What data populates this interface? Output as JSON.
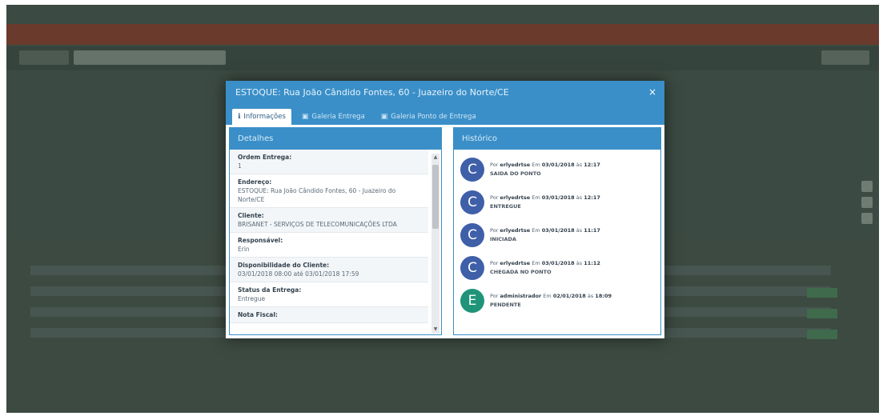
{
  "modal": {
    "title": "ESTOQUE: Rua João Cândido Fontes, 60 - Juazeiro do Norte/CE",
    "close_glyph": "×",
    "tabs": [
      {
        "label": "Informações",
        "icon": "info-icon"
      },
      {
        "label": "Galeria Entrega",
        "icon": "image-icon"
      },
      {
        "label": "Galeria Ponto de Entrega",
        "icon": "image-icon"
      }
    ],
    "details": {
      "title": "Detalhes",
      "fields": [
        {
          "label": "Ordem Entrega:",
          "value": "1"
        },
        {
          "label": "Endereço:",
          "value": "ESTOQUE: Rua João Cândido Fontes, 60 - Juazeiro do Norte/CE"
        },
        {
          "label": "Cliente:",
          "value": "BRISANET - SERVIÇOS DE TELECOMUNICAÇÕES LTDA"
        },
        {
          "label": "Responsável:",
          "value": "Erin"
        },
        {
          "label": "Disponibilidade do Cliente:",
          "value": "03/01/2018 08:00 até 03/01/2018 17:59"
        },
        {
          "label": "Status da Entrega:",
          "value": "Entregue"
        },
        {
          "label": "Nota Fiscal:",
          "value": ""
        }
      ]
    },
    "history": {
      "title": "Histórico",
      "items": [
        {
          "initial": "C",
          "color": "#3f5fa8",
          "by_prefix": "Por",
          "user": "erlyedrtse",
          "em": "Em",
          "date": "03/01/2018",
          "at": "às",
          "time": "12:17",
          "status": "SAIDA DO PONTO"
        },
        {
          "initial": "C",
          "color": "#3f5fa8",
          "by_prefix": "Por",
          "user": "erlyedrtse",
          "em": "Em",
          "date": "03/01/2018",
          "at": "às",
          "time": "12:17",
          "status": "ENTREGUE"
        },
        {
          "initial": "C",
          "color": "#3f5fa8",
          "by_prefix": "Por",
          "user": "erlyedrtse",
          "em": "Em",
          "date": "03/01/2018",
          "at": "às",
          "time": "11:17",
          "status": "INICIADA"
        },
        {
          "initial": "C",
          "color": "#3f5fa8",
          "by_prefix": "Por",
          "user": "erlyedrtse",
          "em": "Em",
          "date": "03/01/2018",
          "at": "às",
          "time": "11:12",
          "status": "CHEGADA NO PONTO"
        },
        {
          "initial": "E",
          "color": "#1f9478",
          "by_prefix": "Por",
          "user": "administrador",
          "em": "Em",
          "date": "02/01/2018",
          "at": "às",
          "time": "18:09",
          "status": "PENDENTE"
        }
      ]
    }
  },
  "colors": {
    "primary": "#3a8fc8",
    "avatar_blue": "#3f5fa8",
    "avatar_green": "#1f9478",
    "overlay": "#3b4a42"
  }
}
